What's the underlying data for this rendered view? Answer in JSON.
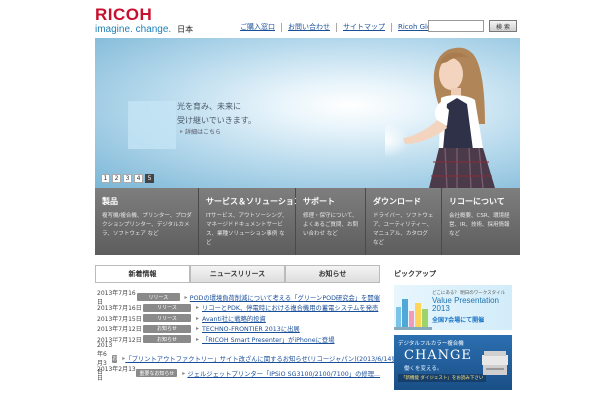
{
  "header": {
    "logo_word": "RICOH",
    "tagline": "imagine. change.",
    "region": "日本",
    "links": [
      "ご購入窓口",
      "お問い合わせ",
      "サイトマップ",
      "Ricoh Global"
    ],
    "search_button": "検 索",
    "search_placeholder": ""
  },
  "hero": {
    "copy_line1": "光を育み、未来に",
    "copy_line2": "受け継いでいきます。",
    "detail_link": "詳細はこちら",
    "pages": [
      "1",
      "2",
      "3",
      "4",
      "5"
    ],
    "active_page": 5
  },
  "categories": [
    {
      "title": "製品",
      "desc": "複写機/複合機、プリンター、プロダクションプリンター、デジタルカメラ、ソフトウェア など"
    },
    {
      "title": "サービス＆ソリューション",
      "desc": "ITサービス、アウトソーシング、マネージドドキュメントサービス、業種ソリューション事例 など"
    },
    {
      "title": "サポート",
      "desc": "修理・保守について、よくあるご質問、お問い合わせ など"
    },
    {
      "title": "ダウンロード",
      "desc": "ドライバー、ソフトウェア、ユーティリティー、マニュアル、カタログ など"
    },
    {
      "title": "リコーについて",
      "desc": "会社概要、CSR、環境経営、IR、技術、採用情報 など"
    }
  ],
  "news": {
    "tabs": [
      "新着情報",
      "ニュースリリース",
      "お知らせ"
    ],
    "items": [
      {
        "date": "2013年7月16日",
        "tag": "リリース",
        "text": "PODの環境負荷削減について考える「グリーンPOD研究会」を開催"
      },
      {
        "date": "2013年7月16日",
        "tag": "リリース",
        "text": "リコーとPDK、停電時における複合機用の蓄電システムを発売"
      },
      {
        "date": "2013年7月15日",
        "tag": "リリース",
        "text": "Avanti社に戦略的投資"
      },
      {
        "date": "2013年7月12日",
        "tag": "お知らせ",
        "text": "TECHNO-FRONTIER 2013に出展"
      },
      {
        "date": "2013年7月12日",
        "tag": "お知らせ",
        "text": "「RICOH Smart Presenter」がiPhoneに登場"
      },
      {
        "date": "2013年6月3日",
        "tag": "重要なお知らせ",
        "text": "「プリントアウトファクトリー」サイト改ざんに関するお知らせ(リコージャパン)(2013/6/14更新)"
      },
      {
        "date": "2013年2月13日",
        "tag": "重要なお知らせ",
        "text": "ジェルジェットプリンター「IPSiO SG3100/2100/7100」の修理..."
      }
    ]
  },
  "pickup": {
    "title": "ピックアップ",
    "banner1": {
      "small": "どこにある？ 明日のワークスタイル",
      "title_line1": "Value Presentation",
      "title_line2": "2013",
      "highlight": "全国7会場にて開催"
    },
    "banner2": {
      "line1": "デジタルフルカラー複合機",
      "headline": "CHANGE",
      "line3": "働くを変える。",
      "badge": "「新機能 ダイジェスト」をお読み下さい"
    }
  },
  "colors": {
    "brand_red": "#c8102e",
    "brand_blue": "#1f7fb8",
    "link_blue": "#1a4f9a",
    "category_bar": "#6e6e6e"
  }
}
